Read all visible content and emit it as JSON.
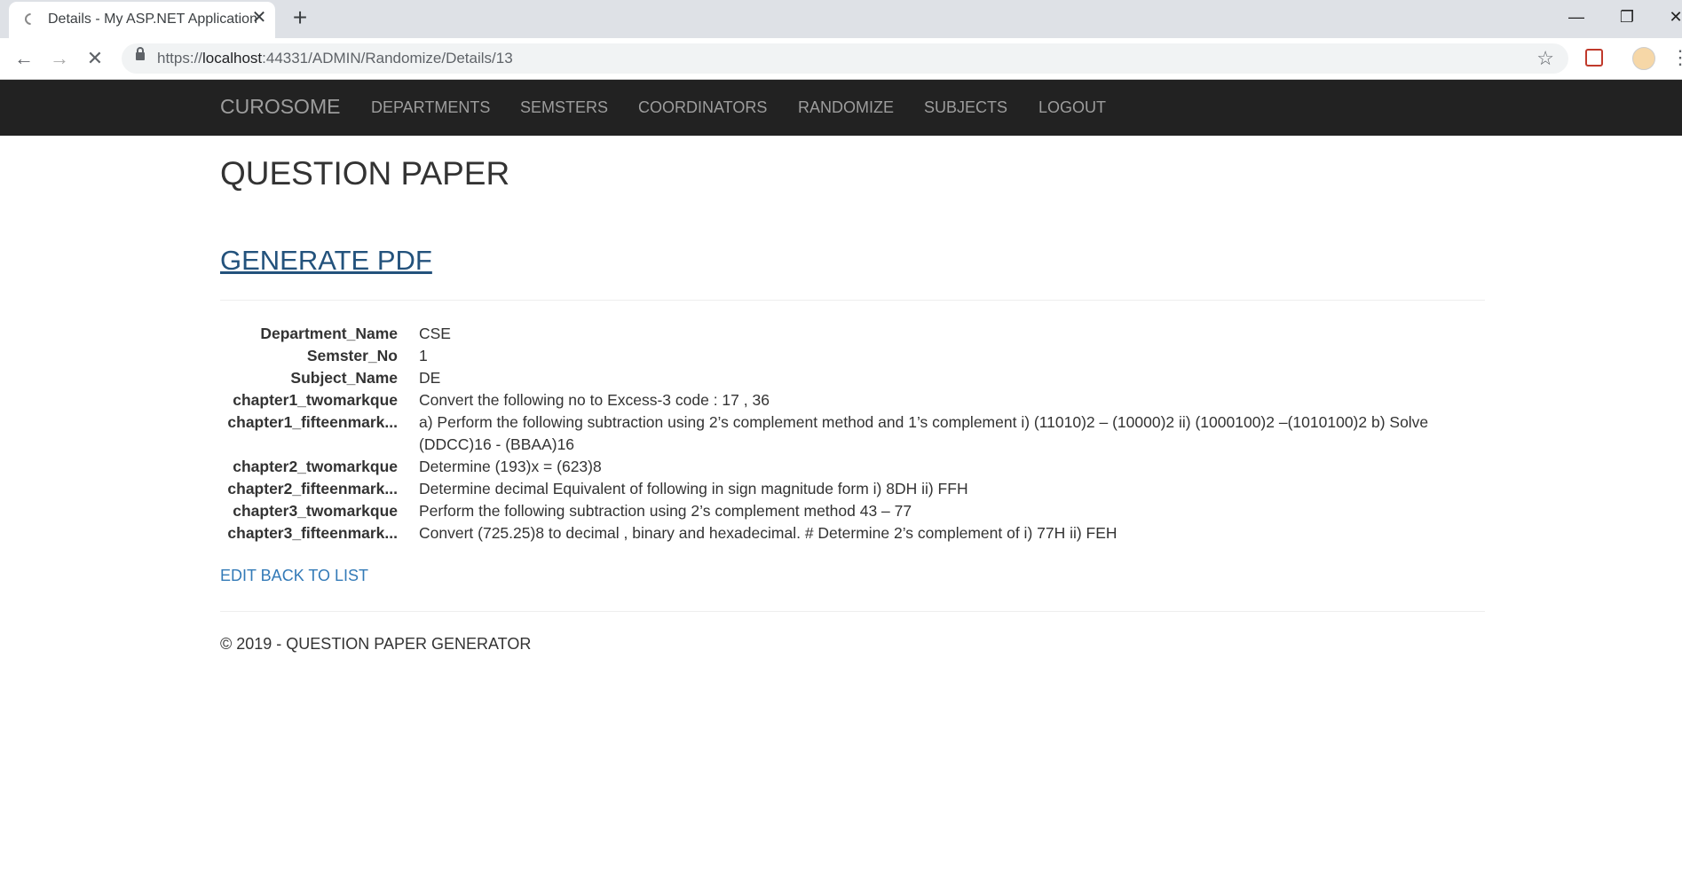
{
  "browser": {
    "tab_title": "Details - My ASP.NET Application",
    "tab_close": "✕",
    "new_tab": "+",
    "minimize": "—",
    "restore": "❐",
    "close": "✕",
    "url_scheme": "https://",
    "url_host": "localhost",
    "url_rest": ":44331/ADMIN/Randomize/Details/13",
    "back": "←",
    "forward": "→",
    "stop": "✕",
    "star": "☆",
    "menu": "⋮"
  },
  "navbar": {
    "brand": "CUROSOME",
    "links": [
      "DEPARTMENTS",
      "SEMSTERS",
      "COORDINATORS",
      "RANDOMIZE",
      "SUBJECTS",
      "LOGOUT"
    ]
  },
  "page": {
    "title": "QUESTION PAPER",
    "generate_pdf": "GENERATE PDF",
    "details": [
      {
        "label": "Department_Name",
        "value": "CSE"
      },
      {
        "label": "Semster_No",
        "value": "1"
      },
      {
        "label": "Subject_Name",
        "value": "DE"
      },
      {
        "label": "chapter1_twomarkque",
        "value": "Convert the following no to Excess-3 code : 17 , 36"
      },
      {
        "label": "chapter1_fifteenmark...",
        "value": "a) Perform the following subtraction using 2’s complement method and 1’s complement i) (11010)2 – (10000)2 ii) (1000100)2 –(1010100)2 b) Solve (DDCC)16 - (BBAA)16"
      },
      {
        "label": "chapter2_twomarkque",
        "value": "Determine (193)x = (623)8"
      },
      {
        "label": "chapter2_fifteenmark...",
        "value": "Determine decimal Equivalent of following in sign magnitude form i) 8DH ii) FFH"
      },
      {
        "label": "chapter3_twomarkque",
        "value": "Perform the following subtraction using 2’s complement method 43 – 77"
      },
      {
        "label": "chapter3_fifteenmark...",
        "value": "Convert (725.25)8 to decimal , binary and hexadecimal. # Determine 2’s complement of i) 77H ii) FEH"
      }
    ],
    "edit_back": "EDIT BACK TO LIST",
    "footer": "© 2019 - QUESTION PAPER GENERATOR"
  }
}
